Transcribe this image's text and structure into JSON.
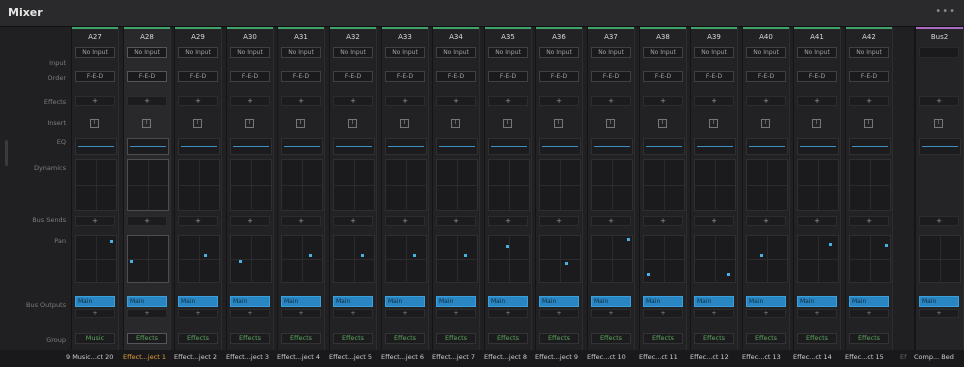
{
  "window": {
    "title": "Mixer",
    "menu_icon": "more-icon"
  },
  "row_labels": [
    "Input",
    "Order",
    "Effects",
    "Insert",
    "EQ",
    "Dynamics",
    "Bus Sends",
    "Pan",
    "Bus Outputs",
    "Group"
  ],
  "selected_channel": "A28",
  "channels": [
    {
      "name": "A27",
      "input": "No Input",
      "order": "F-E-D",
      "insert": "I",
      "pan": [
        0.9,
        0.08
      ],
      "bus_output": "Main",
      "group": "Music",
      "footer": "9 Music...ct 20"
    },
    {
      "name": "A28",
      "input": "No Input",
      "order": "F-E-D",
      "insert": "I",
      "pan": [
        0.05,
        0.55
      ],
      "bus_output": "Main",
      "group": "Effects",
      "footer": "Effect...ject 1"
    },
    {
      "name": "A29",
      "input": "No Input",
      "order": "F-E-D",
      "insert": "I",
      "pan": [
        0.65,
        0.42
      ],
      "bus_output": "Main",
      "group": "Effects",
      "footer": "Effect...ject 2"
    },
    {
      "name": "A30",
      "input": "No Input",
      "order": "F-E-D",
      "insert": "I",
      "pan": [
        0.2,
        0.55
      ],
      "bus_output": "Main",
      "group": "Effects",
      "footer": "Effect...ject 3"
    },
    {
      "name": "A31",
      "input": "No Input",
      "order": "F-E-D",
      "insert": "I",
      "pan": [
        0.7,
        0.42
      ],
      "bus_output": "Main",
      "group": "Effects",
      "footer": "Effect...ject 4"
    },
    {
      "name": "A32",
      "input": "No Input",
      "order": "F-E-D",
      "insert": "I",
      "pan": [
        0.72,
        0.42
      ],
      "bus_output": "Main",
      "group": "Effects",
      "footer": "Effect...ject 5"
    },
    {
      "name": "A33",
      "input": "No Input",
      "order": "F-E-D",
      "insert": "I",
      "pan": [
        0.72,
        0.42
      ],
      "bus_output": "Main",
      "group": "Effects",
      "footer": "Effect...ject 6"
    },
    {
      "name": "A34",
      "input": "No Input",
      "order": "F-E-D",
      "insert": "I",
      "pan": [
        0.72,
        0.42
      ],
      "bus_output": "Main",
      "group": "Effects",
      "footer": "Effect...ject 7"
    },
    {
      "name": "A35",
      "input": "No Input",
      "order": "F-E-D",
      "insert": "I",
      "pan": [
        0.45,
        0.2
      ],
      "bus_output": "Main",
      "group": "Effects",
      "footer": "Effect...ject 8"
    },
    {
      "name": "A36",
      "input": "No Input",
      "order": "F-E-D",
      "insert": "I",
      "pan": [
        0.65,
        0.6
      ],
      "bus_output": "Main",
      "group": "Effects",
      "footer": "Effect...ject 9"
    },
    {
      "name": "A37",
      "input": "No Input",
      "order": "F-E-D",
      "insert": "I",
      "pan": [
        0.92,
        0.05
      ],
      "bus_output": "Main",
      "group": "Effects",
      "footer": "Effec...ct 10"
    },
    {
      "name": "A38",
      "input": "No Input",
      "order": "F-E-D",
      "insert": "I",
      "pan": [
        0.08,
        0.85
      ],
      "bus_output": "Main",
      "group": "Effects",
      "footer": "Effec...ct 11"
    },
    {
      "name": "A39",
      "input": "No Input",
      "order": "F-E-D",
      "insert": "I",
      "pan": [
        0.85,
        0.85
      ],
      "bus_output": "Main",
      "group": "Effects",
      "footer": "Effec...ct 12"
    },
    {
      "name": "A40",
      "input": "No Input",
      "order": "F-E-D",
      "insert": "I",
      "pan": [
        0.35,
        0.4
      ],
      "bus_output": "Main",
      "group": "Effects",
      "footer": "Effec...ct 13"
    },
    {
      "name": "A41",
      "input": "No Input",
      "order": "F-E-D",
      "insert": "I",
      "pan": [
        0.82,
        0.15
      ],
      "bus_output": "Main",
      "group": "Effects",
      "footer": "Effec...ct 14"
    },
    {
      "name": "A42",
      "input": "No Input",
      "order": "F-E-D",
      "insert": "I",
      "pan": [
        0.92,
        0.18
      ],
      "bus_output": "Main",
      "group": "Effects",
      "footer": "Effec...ct 15"
    }
  ],
  "bus": {
    "name": "Bus2",
    "insert": "I",
    "bus_output": "Main",
    "footer": "Comp... Bed"
  },
  "footer_prefix_bus": "Ef",
  "colors": {
    "track_accent": "#3fa268",
    "bus_accent": "#a86ac2",
    "pan_dot": "#49b0e6",
    "bus_output": "#2a86c2",
    "group_text": "#5ea85e",
    "selected_footer": "#e4a13a"
  }
}
